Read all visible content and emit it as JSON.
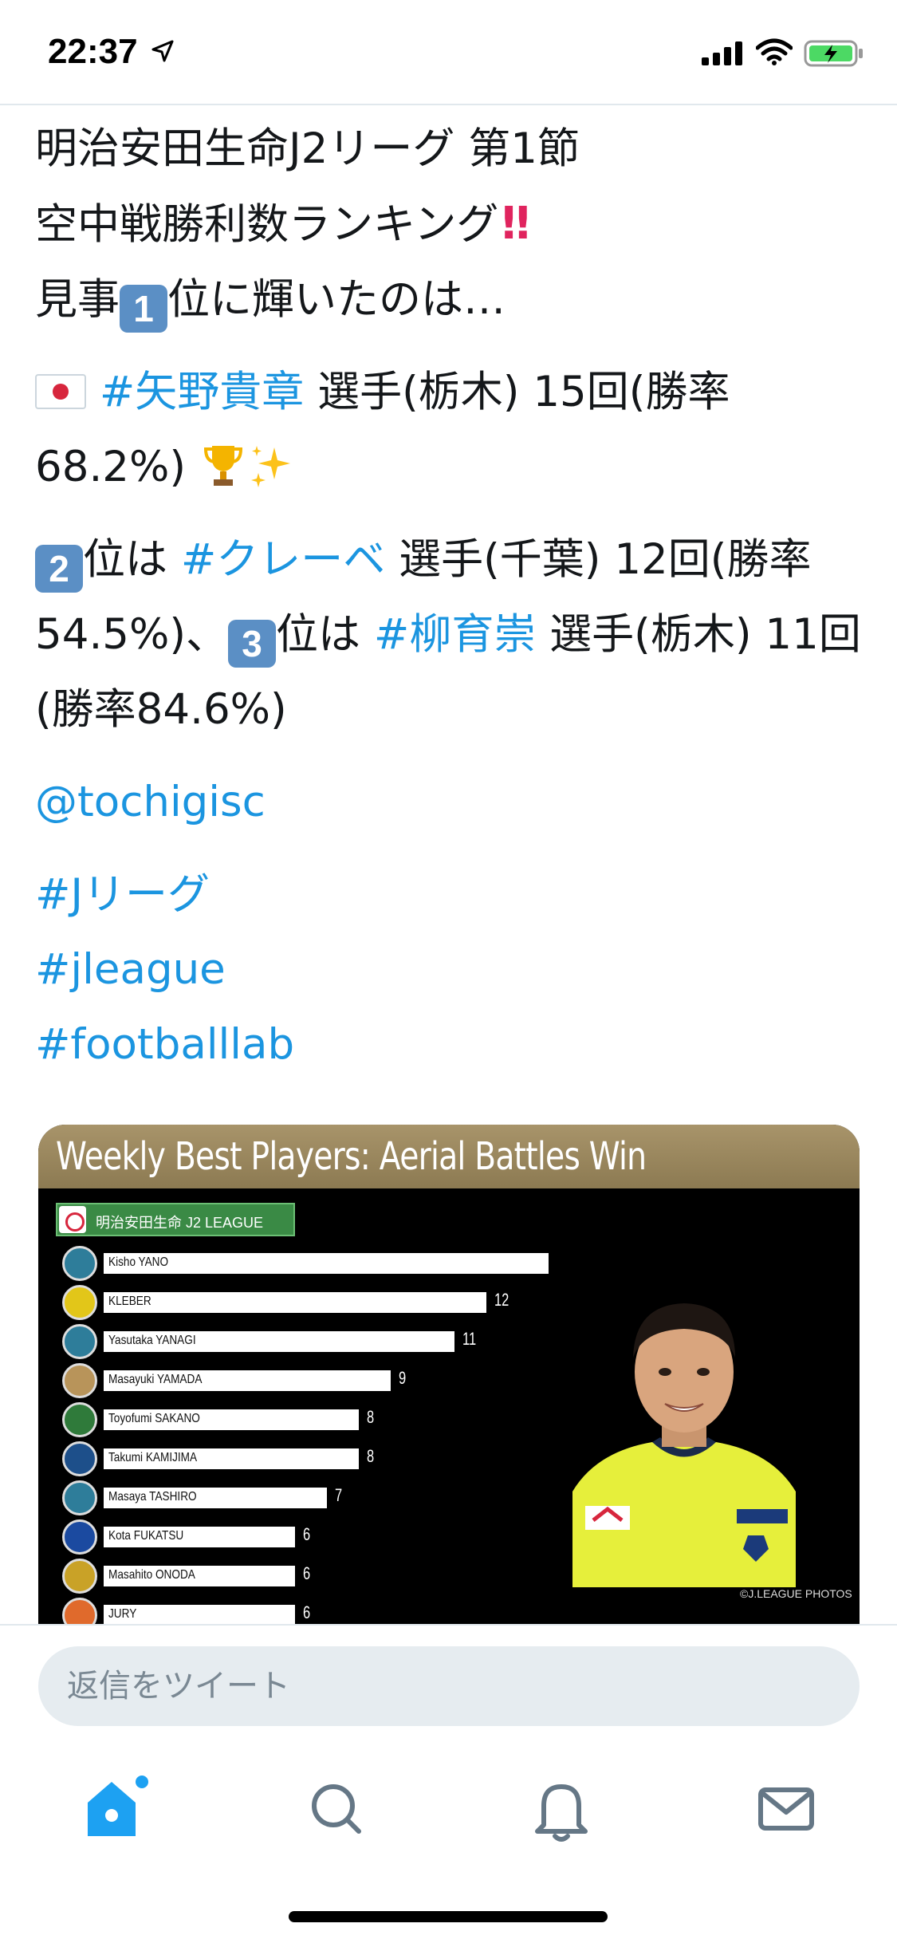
{
  "status_bar": {
    "time": "22:37"
  },
  "tweet": {
    "line1": "明治安田生命J2リーグ 第1節",
    "line2": "空中戦勝利数ランキング",
    "line3_pre": "見事",
    "line3_rank": "1",
    "line3_post": "位に輝いたのは…",
    "p2_hashtag": "#矢野貴章",
    "p2_text": " 選手(栃木) 15回(勝率68.2%)",
    "p3_rank2": "2",
    "p3_text1": "位は ",
    "p3_hashtag1": "#クレーベ",
    "p3_text2": " 選手(千葉) 12回(勝率54.5%)、",
    "p3_rank3": "3",
    "p3_text3": "位は ",
    "p3_hashtag2": "#柳育崇",
    "p3_text4": " 選手(栃木) 11回(勝率84.6%)",
    "mention": "@tochigisc",
    "hashtags": [
      "#Jリーグ",
      "#jleague",
      "#footballlab"
    ]
  },
  "image_card": {
    "title": "Weekly Best Players: Aerial Battles Win",
    "league": "明治安田生命 J2 LEAGUE",
    "photo_credit": "©J.LEAGUE PHOTOS",
    "max_value": 15,
    "rows": [
      {
        "name": "Kisho YANO",
        "value": 15,
        "crest": "#2e7d9a"
      },
      {
        "name": "KLEBER",
        "value": 12,
        "crest": "#e2c619"
      },
      {
        "name": "Yasutaka YANAGI",
        "value": 11,
        "crest": "#2e7d9a"
      },
      {
        "name": "Masayuki YAMADA",
        "value": 9,
        "crest": "#b8945a"
      },
      {
        "name": "Toyofumi SAKANO",
        "value": 8,
        "crest": "#2f7a3a"
      },
      {
        "name": "Takumi KAMIJIMA",
        "value": 8,
        "crest": "#1d4f8a"
      },
      {
        "name": "Masaya TASHIRO",
        "value": 7,
        "crest": "#2e7d9a"
      },
      {
        "name": "Kota FUKATSU",
        "value": 6,
        "crest": "#1b4aa0"
      },
      {
        "name": "Masahito ONODA",
        "value": 6,
        "crest": "#c9a227"
      },
      {
        "name": "JURY",
        "value": 6,
        "crest": "#e06a2c"
      }
    ]
  },
  "reply": {
    "placeholder": "返信をツイート"
  },
  "tabs": [
    {
      "name": "home-icon",
      "active": true
    },
    {
      "name": "search-icon",
      "active": false
    },
    {
      "name": "notifications-icon",
      "active": false
    },
    {
      "name": "messages-icon",
      "active": false
    }
  ],
  "colors": {
    "link": "#1b95e0",
    "accent": "#1da1f2",
    "header_gold": "#a8946a"
  }
}
